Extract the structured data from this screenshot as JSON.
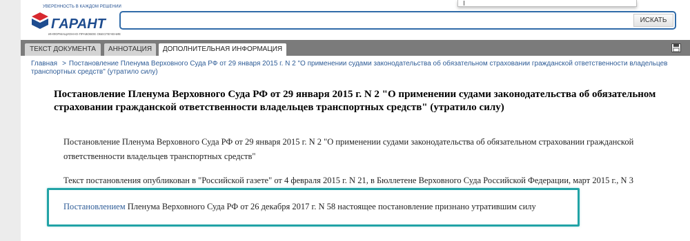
{
  "header": {
    "tagline": "УВЕРЕННОСТЬ В КАЖДОМ РЕШЕНИИ",
    "logo_text": "ГАРАНТ",
    "logo_sub": "ИНФОРМАЦИОННО-ПРАВОВОЕ ОБЕСПЕЧЕНИЕ",
    "search": {
      "value": "",
      "placeholder": "",
      "button_label": "ИСКАТЬ"
    }
  },
  "tabs": [
    {
      "label": "ТЕКСТ ДОКУМЕНТА",
      "active": false
    },
    {
      "label": "АННОТАЦИЯ",
      "active": false
    },
    {
      "label": "ДОПОЛНИТЕЛЬНАЯ ИНФОРМАЦИЯ",
      "active": true
    }
  ],
  "breadcrumb": {
    "home": "Главная",
    "separator": ">",
    "current": "Постановление Пленума Верховного Суда РФ от 29 января 2015 г. N 2 \"О применении судами законодательства об обязательном страховании гражданской ответственности владельцев транспортных средств\" (утратило силу)"
  },
  "document": {
    "title": "Постановление Пленума Верховного Суда РФ от 29 января 2015 г. N 2 \"О применении судами законодательства об обязательном страховании гражданской ответственности владельцев транспортных средств\" (утратило силу)",
    "para1": "Постановление Пленума Верховного Суда РФ от 29 января 2015 г. N 2 \"О применении судами законодательства об обязательном страховании гражданской ответственности владельцев транспортных средств\"",
    "para2": "Текст постановления опубликован в \"Российской газете\" от 4 февраля 2015 г. N 21, в Бюллетене Верховного Суда Российской Федерации, март 2015 г., N 3",
    "para3_link": "Постановлением",
    "para3_rest": " Пленума Верховного Суда РФ от 26 декабря 2017 г. N 58 настоящее постановление признано утратившим силу"
  },
  "colors": {
    "accent_blue": "#2f6aa8",
    "link": "#2d5b96",
    "tabbar": "#7b7b7b",
    "highlight": "#21a3a6",
    "logo_red": "#d7282f"
  },
  "icons": {
    "save": "floppy-disk-icon",
    "logo": "garant-logo"
  }
}
